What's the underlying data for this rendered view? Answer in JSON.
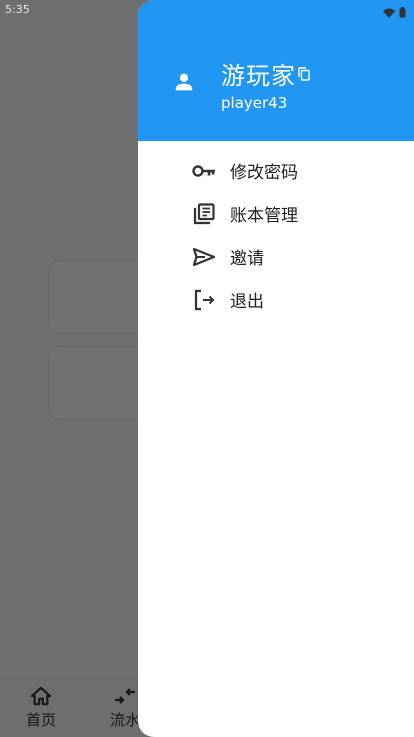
{
  "status_bar": {
    "time": "5:35"
  },
  "bottom_nav": {
    "items": [
      {
        "label": "首页",
        "icon": "home-icon"
      },
      {
        "label": "流水",
        "icon": "transfer-icon"
      }
    ]
  },
  "drawer": {
    "header": {
      "username": "游玩家",
      "user_id": "player43",
      "header_color": "#2196f3"
    },
    "menu": [
      {
        "label": "修改密码",
        "icon": "key-icon"
      },
      {
        "label": "账本管理",
        "icon": "ledger-icon"
      },
      {
        "label": "邀请",
        "icon": "send-icon"
      },
      {
        "label": "退出",
        "icon": "logout-icon"
      }
    ]
  }
}
